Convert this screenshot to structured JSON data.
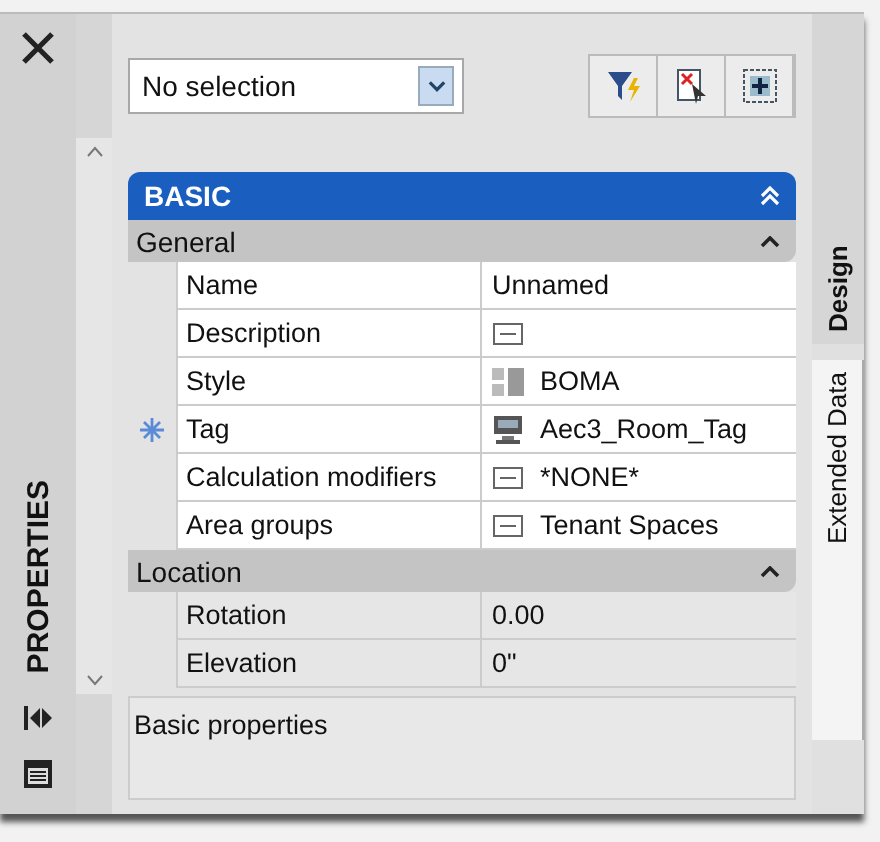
{
  "palette": {
    "title": "PROPERTIES"
  },
  "selector": {
    "value": "No selection"
  },
  "category": {
    "title": "BASIC",
    "expanded": true
  },
  "sections": [
    {
      "title": "General",
      "expanded": true,
      "greyed": false,
      "rows": [
        {
          "name": "Name",
          "value": "Unnamed",
          "kind": "text",
          "marker": false
        },
        {
          "name": "Description",
          "kind": "field",
          "marker": false
        },
        {
          "name": "Style",
          "value": "BOMA",
          "kind": "style",
          "marker": false
        },
        {
          "name": "Tag",
          "value": "Aec3_Room_Tag",
          "kind": "tag",
          "marker": true
        },
        {
          "name": "Calculation modifiers",
          "value": "*NONE*",
          "kind": "field",
          "marker": false
        },
        {
          "name": "Area groups",
          "value": "Tenant Spaces",
          "kind": "field",
          "marker": false
        }
      ]
    },
    {
      "title": "Location",
      "expanded": true,
      "greyed": true,
      "rows": [
        {
          "name": "Rotation",
          "value": "0.00",
          "kind": "text",
          "marker": false
        },
        {
          "name": "Elevation",
          "value": "0\"",
          "kind": "text",
          "marker": false
        }
      ]
    }
  ],
  "description": "Basic properties",
  "side_tabs": [
    {
      "label": "Design",
      "selected": true
    },
    {
      "label": "Extended Data",
      "selected": false
    }
  ]
}
